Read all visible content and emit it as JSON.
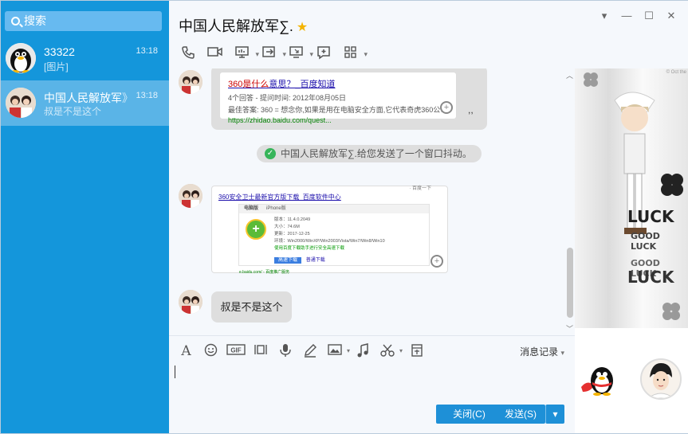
{
  "sidebar": {
    "search_placeholder": "搜索",
    "conversations": [
      {
        "name": "33322",
        "preview": "[图片]",
        "time": "13:18"
      },
      {
        "name": "中国人民解放军",
        "name_suffix": "》",
        "preview": "叔是不是这个",
        "time": "13:18"
      }
    ]
  },
  "header": {
    "title": "中国人民解放军∑.",
    "window_buttons": [
      "▾",
      "—",
      "☐",
      "✕"
    ]
  },
  "chat": {
    "card1": {
      "link_highlight": "360是什么",
      "link_rest": "意思？_百度知道",
      "meta": "4个回答 - 提问时间: 2012年08月05日",
      "answer": "最佳答案: 360 = 想念你,如果是用在电脑安全方面,它代表奇虎360公司",
      "url": "https://zhidao.baidu.com/quest..."
    },
    "notice": "中国人民解放军∑.给您发送了一个窗口抖动。",
    "card2": {
      "top_right": "· 百度一下",
      "link": "360安全卫士最新官方版下载_百度软件中心",
      "tabs": [
        "电脑版",
        "iPhone版"
      ],
      "version": "版本：11.4.0.2049",
      "size": "大小：74.6M",
      "updated": "更新：2017-12-25",
      "env": "环境：Win2000/WinXP/Win2003/Vista/Win7/Win8/Win10",
      "secure": "使用百度下载助手进行安全高速下载",
      "btn1": "高速下载",
      "btn2": "普通下载",
      "url": "e.baidu.com/ - 百度推广服务"
    },
    "last_message": "叔是不是这个",
    "ellipsis": ",,"
  },
  "input": {
    "history_label": "消息记录",
    "close_label": "关闭(C)",
    "send_label": "发送(S)"
  },
  "side": {
    "corner_text": "© Oct the",
    "luck_text_1": "LUCK",
    "luck_text_2": "GOOD LUCK",
    "luck_text_3": "GOOD LUCK",
    "luck_text_4": "LUCK"
  }
}
